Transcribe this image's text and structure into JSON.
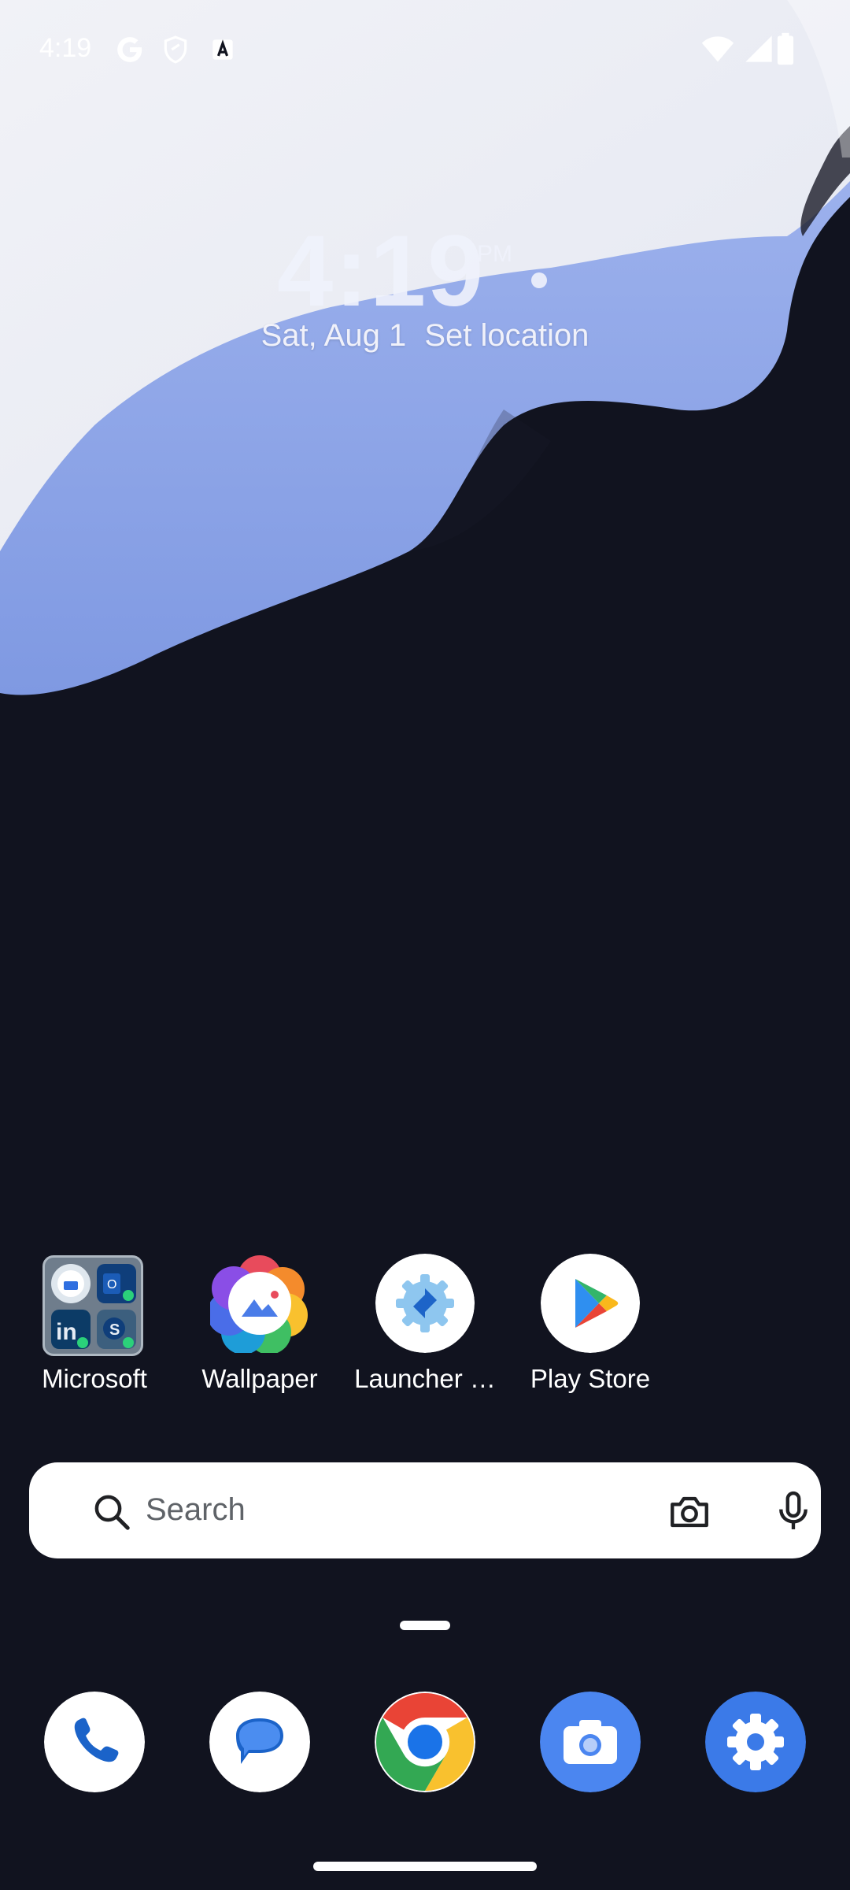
{
  "status_bar": {
    "time": "4:19",
    "left_icons": [
      "google-icon",
      "shield-icon",
      "font-icon"
    ],
    "right_icons": [
      "wifi-icon",
      "signal-icon",
      "battery-icon"
    ]
  },
  "clock_widget": {
    "time": "4:19",
    "ampm": "PM",
    "date": "Sat, Aug 1",
    "location": "Set location"
  },
  "home_apps": [
    {
      "label": "Microsoft",
      "type": "folder",
      "contents": [
        "microsoft-launcher-icon",
        "outlook-icon",
        "linkedin-icon",
        "skype-icon"
      ]
    },
    {
      "label": "Wallpaper",
      "icon": "wallpaper-icon"
    },
    {
      "label": "Launcher …",
      "icon": "launcher-settings-icon"
    },
    {
      "label": "Play Store",
      "icon": "play-store-icon"
    }
  ],
  "search": {
    "placeholder": "Search",
    "icons": [
      "search-icon",
      "camera-icon",
      "microphone-icon"
    ]
  },
  "dock": [
    {
      "name": "phone",
      "icon": "phone-icon"
    },
    {
      "name": "messages",
      "icon": "messages-icon"
    },
    {
      "name": "chrome",
      "icon": "chrome-icon"
    },
    {
      "name": "camera",
      "icon": "camera-icon"
    },
    {
      "name": "settings",
      "icon": "settings-gear-icon"
    }
  ],
  "colors": {
    "background": "#11131f",
    "wallpaper_light": "#eef0f7",
    "wallpaper_blue": "#9eb3ec",
    "dock_blue": "#2f6fe0",
    "search_bg": "#ffffff"
  }
}
